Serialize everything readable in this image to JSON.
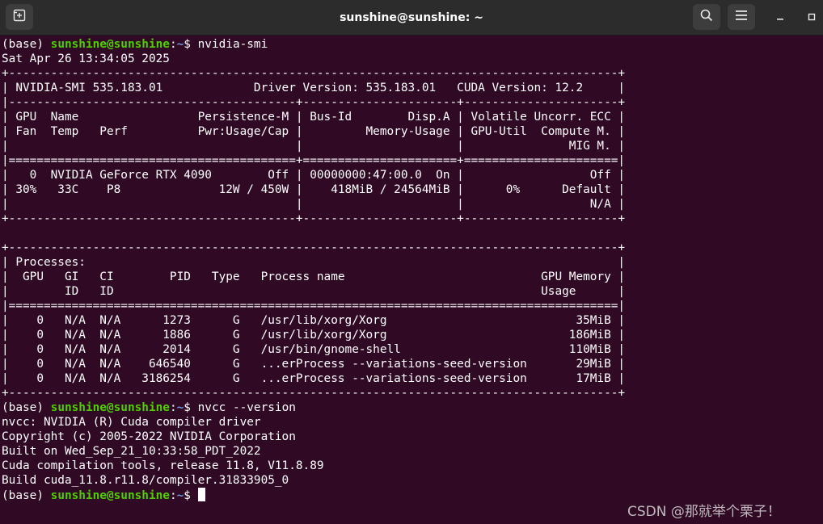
{
  "window": {
    "title": "sunshine@sunshine: ~"
  },
  "titlebar": {
    "new_tab_icon": "new-tab-icon",
    "search_icon": "search-icon",
    "menu_icon": "hamburger-menu-icon",
    "minimize_icon": "minimize-icon",
    "maximize_icon": "maximize-icon"
  },
  "colors": {
    "background": "#300a24",
    "titlebar": "#2c2c2c",
    "text": "#ffffff",
    "prompt_userhost": "#4ed000",
    "prompt_path": "#6f95e0"
  },
  "prompt": {
    "env": "(base) ",
    "userhost": "sunshine@sunshine",
    "colon": ":",
    "path": "~",
    "symbol": "$ "
  },
  "commands": {
    "first": "nvidia-smi",
    "second": "nvcc --version"
  },
  "smi_output": [
    "Sat Apr 26 13:34:05 2025",
    "+---------------------------------------------------------------------------------------+",
    "| NVIDIA-SMI 535.183.01             Driver Version: 535.183.01   CUDA Version: 12.2     |",
    "|-----------------------------------------+----------------------+----------------------+",
    "| GPU  Name                 Persistence-M | Bus-Id        Disp.A | Volatile Uncorr. ECC |",
    "| Fan  Temp   Perf          Pwr:Usage/Cap |         Memory-Usage | GPU-Util  Compute M. |",
    "|                                         |                      |               MIG M. |",
    "|=========================================+======================+======================|",
    "|   0  NVIDIA GeForce RTX 4090        Off | 00000000:47:00.0  On |                  Off |",
    "| 30%   33C    P8              12W / 450W |    418MiB / 24564MiB |      0%      Default |",
    "|                                         |                      |                  N/A |",
    "+-----------------------------------------+----------------------+----------------------+",
    "",
    "+---------------------------------------------------------------------------------------+",
    "| Processes:                                                                            |",
    "|  GPU   GI   CI        PID   Type   Process name                            GPU Memory |",
    "|        ID   ID                                                             Usage      |",
    "|=======================================================================================|",
    "|    0   N/A  N/A      1273      G   /usr/lib/xorg/Xorg                           35MiB |",
    "|    0   N/A  N/A      1886      G   /usr/lib/xorg/Xorg                          186MiB |",
    "|    0   N/A  N/A      2014      G   /usr/bin/gnome-shell                        110MiB |",
    "|    0   N/A  N/A    646540      G   ...erProcess --variations-seed-version       29MiB |",
    "|    0   N/A  N/A   3186254      G   ...erProcess --variations-seed-version       17MiB |",
    "+---------------------------------------------------------------------------------------+"
  ],
  "nvcc_output": [
    "nvcc: NVIDIA (R) Cuda compiler driver",
    "Copyright (c) 2005-2022 NVIDIA Corporation",
    "Built on Wed_Sep_21_10:33:58_PDT_2022",
    "Cuda compilation tools, release 11.8, V11.8.89",
    "Build cuda_11.8.r11.8/compiler.31833905_0"
  ],
  "watermark": "CSDN @那就举个栗子！"
}
